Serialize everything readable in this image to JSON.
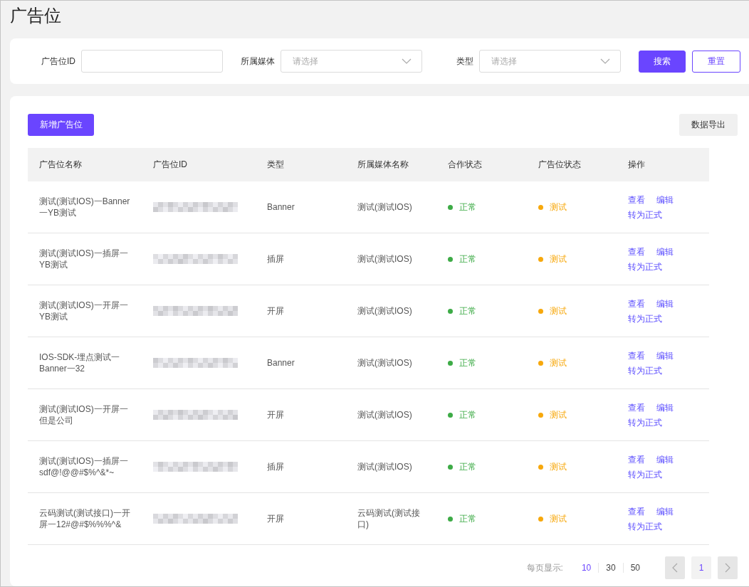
{
  "page_title": "广告位",
  "filters": [
    {
      "label": "广告位ID",
      "kind": "input"
    },
    {
      "label": "所属媒体",
      "kind": "select",
      "placeholder": "请选择"
    },
    {
      "label": "类型",
      "kind": "select",
      "placeholder": "请选择"
    }
  ],
  "filter_buttons": [
    {
      "label": "搜索",
      "kind": "primary"
    },
    {
      "label": "重置",
      "kind": "outline"
    }
  ],
  "add_button": "新增广告位",
  "export_button": "数据导出",
  "table": {
    "columns": [
      "广告位名称",
      "广告位ID",
      "类型",
      "所属媒体名称",
      "合作状态",
      "广告位状态",
      "操作"
    ],
    "rows": [
      {
        "name": "测试(测试IOS)一Banner一YB测试",
        "type": "Banner",
        "media": "测试(测试IOS)",
        "cooperation": {
          "label": "正常",
          "color": "#3dab46"
        },
        "status": {
          "label": "测试",
          "color": "#f7a80c"
        },
        "actions": [
          "查看",
          "编辑",
          "转为正式"
        ]
      },
      {
        "name": "测试(测试IOS)一插屏一YB测试",
        "type": "插屏",
        "media": "测试(测试IOS)",
        "cooperation": {
          "label": "正常",
          "color": "#3dab46"
        },
        "status": {
          "label": "测试",
          "color": "#f7a80c"
        },
        "actions": [
          "查看",
          "编辑",
          "转为正式"
        ]
      },
      {
        "name": "测试(测试IOS)一开屏一YB测试",
        "type": "开屏",
        "media": "测试(测试IOS)",
        "cooperation": {
          "label": "正常",
          "color": "#3dab46"
        },
        "status": {
          "label": "测试",
          "color": "#f7a80c"
        },
        "actions": [
          "查看",
          "编辑",
          "转为正式"
        ]
      },
      {
        "name": "IOS-SDK-埋点测试一Banner一32",
        "type": "Banner",
        "media": "测试(测试IOS)",
        "cooperation": {
          "label": "正常",
          "color": "#3dab46"
        },
        "status": {
          "label": "测试",
          "color": "#f7a80c"
        },
        "actions": [
          "查看",
          "编辑",
          "转为正式"
        ]
      },
      {
        "name": "测试(测试IOS)一开屏一但是公司",
        "type": "开屏",
        "media": "测试(测试IOS)",
        "cooperation": {
          "label": "正常",
          "color": "#3dab46"
        },
        "status": {
          "label": "测试",
          "color": "#f7a80c"
        },
        "actions": [
          "查看",
          "编辑",
          "转为正式"
        ]
      },
      {
        "name": "测试(测试IOS)一插屏一sdf@!@@#$%^&*~",
        "type": "插屏",
        "media": "测试(测试IOS)",
        "cooperation": {
          "label": "正常",
          "color": "#3dab46"
        },
        "status": {
          "label": "测试",
          "color": "#f7a80c"
        },
        "actions": [
          "查看",
          "编辑",
          "转为正式"
        ]
      },
      {
        "name": "云码测试(测试接口)一开屏一12#@#$%%%^&",
        "type": "开屏",
        "media": "云码测试(测试接口)",
        "cooperation": {
          "label": "正常",
          "color": "#3dab46"
        },
        "status": {
          "label": "测试",
          "color": "#f7a80c"
        },
        "actions": [
          "查看",
          "编辑",
          "转为正式"
        ]
      }
    ]
  },
  "pagination": {
    "label": "每页显示:",
    "sizes": [
      {
        "label": "10",
        "selected": true
      },
      {
        "label": "30",
        "selected": false
      },
      {
        "label": "50",
        "selected": false
      }
    ],
    "pages": [
      {
        "label": "1",
        "selected": true
      }
    ],
    "prev_disabled": true,
    "next_disabled": true
  }
}
